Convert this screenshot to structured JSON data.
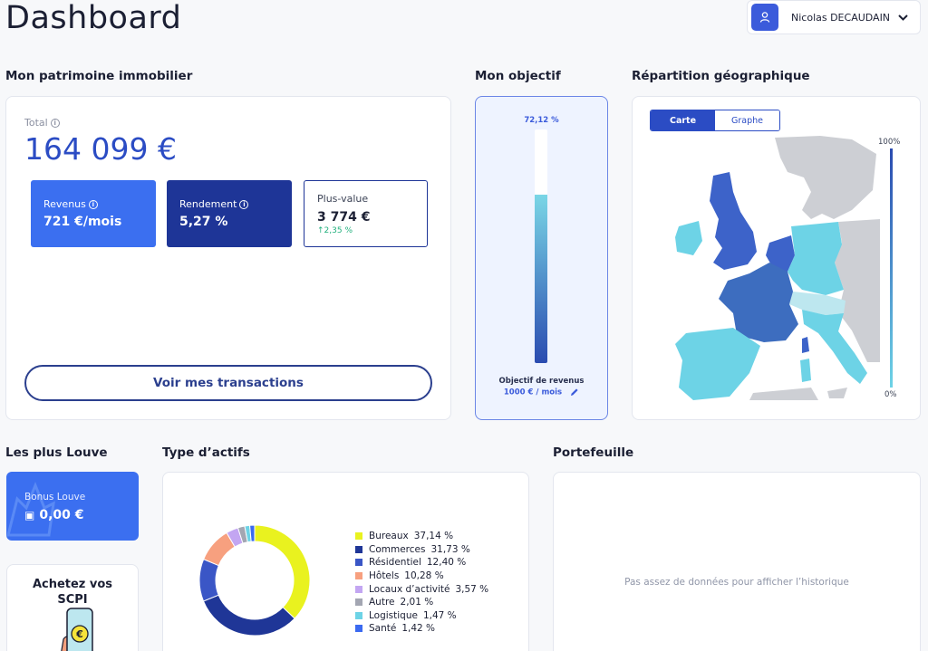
{
  "page_title": "Dashboard",
  "user": {
    "name": "Nicolas DECAUDAIN",
    "icon": "user-icon"
  },
  "patrimoine": {
    "section_title": "Mon patrimoine immobilier",
    "total_label": "Total",
    "total_value": "164 099 €",
    "revenus": {
      "label": "Revenus",
      "value": "721 €/mois"
    },
    "rendement": {
      "label": "Rendement",
      "value": "5,27 %"
    },
    "plus_value": {
      "label": "Plus-value",
      "value": "3 774 €",
      "delta": "2,35 %"
    },
    "transactions_button": "Voir mes transactions"
  },
  "objectif": {
    "section_title": "Mon objectif",
    "percent_label": "72,12 %",
    "progress": 0.7212,
    "caption": "Objectif de revenus",
    "amount": "1000 € / mois"
  },
  "geo": {
    "section_title": "Répartition géographique",
    "tabs": [
      "Carte",
      "Graphe"
    ],
    "active_tab": "Carte",
    "scale_max": "100%",
    "scale_min": "0%"
  },
  "louve": {
    "section_title": "Les plus Louve",
    "bonus_label": "Bonus Louve",
    "bonus_value": "0,00 €",
    "promo_title_line1": "Achetez vos",
    "promo_title_line2": "SCPI"
  },
  "actifs": {
    "section_title": "Type d’actifs"
  },
  "chart_data": {
    "type": "pie",
    "categories": [
      "Bureaux",
      "Commerces",
      "Résidentiel",
      "Hôtels",
      "Locaux d’activité",
      "Autre",
      "Logistique",
      "Santé"
    ],
    "values": [
      37.14,
      31.73,
      12.4,
      10.28,
      3.57,
      2.01,
      1.47,
      1.42
    ],
    "value_labels": [
      "37,14 %",
      "31,73 %",
      "12,40 %",
      "10,28 %",
      "3,57 %",
      "2,01 %",
      "1,47 %",
      "1,42 %"
    ],
    "colors": [
      "#e9f21f",
      "#1f3697",
      "#3a56c6",
      "#f7a07f",
      "#c3a6f2",
      "#a3a6b2",
      "#6dd3e6",
      "#3b6af0"
    ],
    "legend_placement": "right"
  },
  "portefeuille": {
    "section_title": "Portefeuille",
    "empty_message": "Pas assez de données pour afficher l’historique"
  },
  "colors": {
    "primary": "#2b4cc4",
    "navy": "#1e3597",
    "light_blue": "#3b6ff0",
    "positive": "#22b07d"
  }
}
